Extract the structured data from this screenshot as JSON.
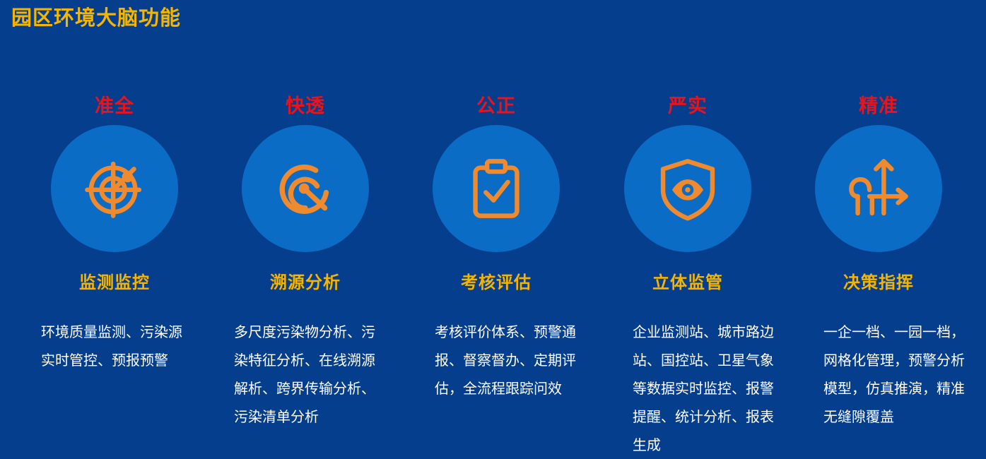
{
  "page": {
    "title": "园区环境大脑功能"
  },
  "features": [
    {
      "tag": "准全",
      "icon": "radar-icon",
      "name": "监测监控",
      "description": "环境质量监测、污染源实时管控、预报预警"
    },
    {
      "tag": "快透",
      "icon": "trace-source-icon",
      "name": "溯源分析",
      "description": "多尺度污染物分析、污染特征分析、在线溯源解析、跨界传输分析、污染清单分析"
    },
    {
      "tag": "公正",
      "icon": "clipboard-check-icon",
      "name": "考核评估",
      "description": "考核评价体系、预警通报、督察督办、定期评估，全流程跟踪问效"
    },
    {
      "tag": "严实",
      "icon": "shield-eye-icon",
      "name": "立体监管",
      "description": "企业监测站、城市路边站、国控站、卫星气象等数据实时监控、报警提醒、统计分析、报表生成"
    },
    {
      "tag": "精准",
      "icon": "decision-arrows-icon",
      "name": "决策指挥",
      "description": "一企一档、一园一档，网格化管理，预警分析模型，仿真推演，精准无缝隙覆盖"
    }
  ],
  "colors": {
    "background": "#053e8c",
    "circle": "#0a6cc4",
    "icon": "#ef8a2e",
    "title": "#f5b400",
    "tag": "#e8141c",
    "text": "#ffffff"
  }
}
